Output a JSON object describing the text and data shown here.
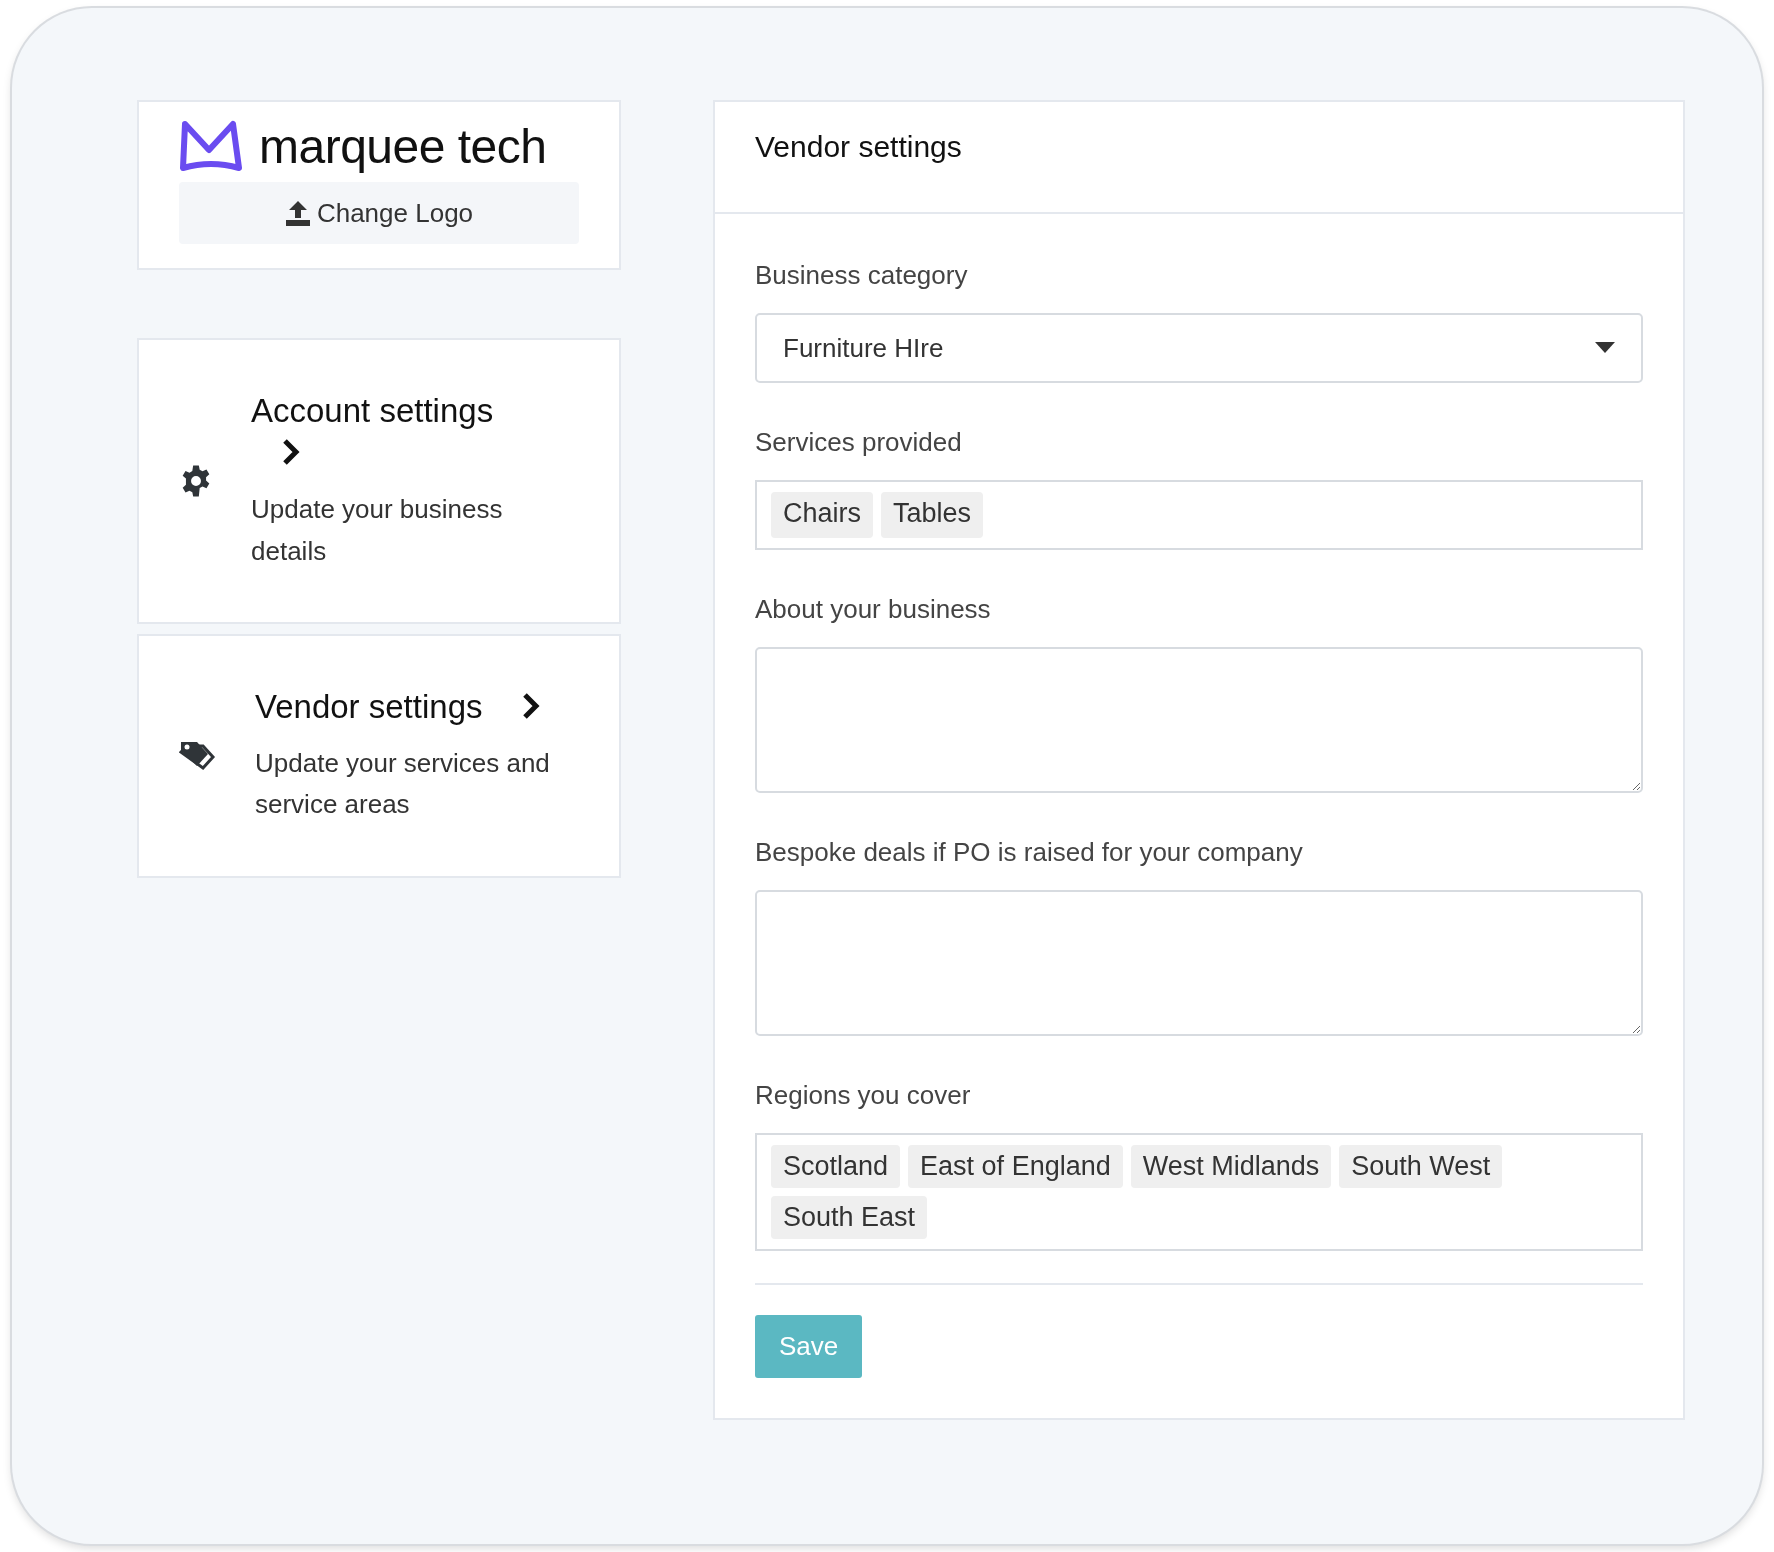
{
  "brand": {
    "name": "marquee tech",
    "change_logo": "Change Logo"
  },
  "nav": [
    {
      "kind": "gear",
      "title": "Account settings",
      "description": "Update your business details"
    },
    {
      "kind": "tag",
      "title": "Vendor settings",
      "description": "Update your services and service areas"
    }
  ],
  "panel": {
    "title": "Vendor settings",
    "fields": [
      {
        "kind": "select",
        "label": "Business category",
        "value": "Furniture HIre"
      },
      {
        "kind": "tags",
        "label": "Services provided",
        "tags": [
          "Chairs",
          "Tables"
        ]
      },
      {
        "kind": "textarea",
        "label": "About your business"
      },
      {
        "kind": "textarea",
        "label": "Bespoke deals if PO is raised for your company"
      },
      {
        "kind": "tags",
        "label": "Regions you cover",
        "tags": [
          "Scotland",
          "East of England",
          "West Midlands",
          "South West",
          "South East"
        ]
      }
    ],
    "save": "Save"
  }
}
